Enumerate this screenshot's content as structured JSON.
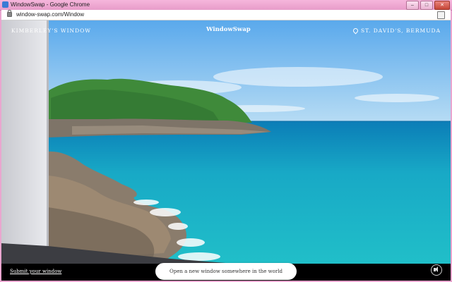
{
  "browser": {
    "title": "WindowSwap - Google Chrome",
    "url": "window-swap.com/Window",
    "controls": [
      "–",
      "□",
      "✕"
    ]
  },
  "page": {
    "window_owner": "KIMBERLEY'S WINDOW",
    "brand": "WindowSwap",
    "location": "ST. DAVID'S, BERMUDA",
    "submit_link": "Submit your window",
    "open_button": "Open a new window somewhere in the world"
  },
  "colors": {
    "sky": "#6db6ee",
    "sea_turquoise": "#1cb6c8",
    "sea_deep": "#0e7fb6",
    "vegetation": "#3f8a3a",
    "rock": "#8a7c6c",
    "frame_pink": "#e9a6cf"
  },
  "icons": {
    "lock": "lock-icon",
    "extension": "extension-icon",
    "pin": "map-pin-icon",
    "sound": "speaker-icon"
  }
}
